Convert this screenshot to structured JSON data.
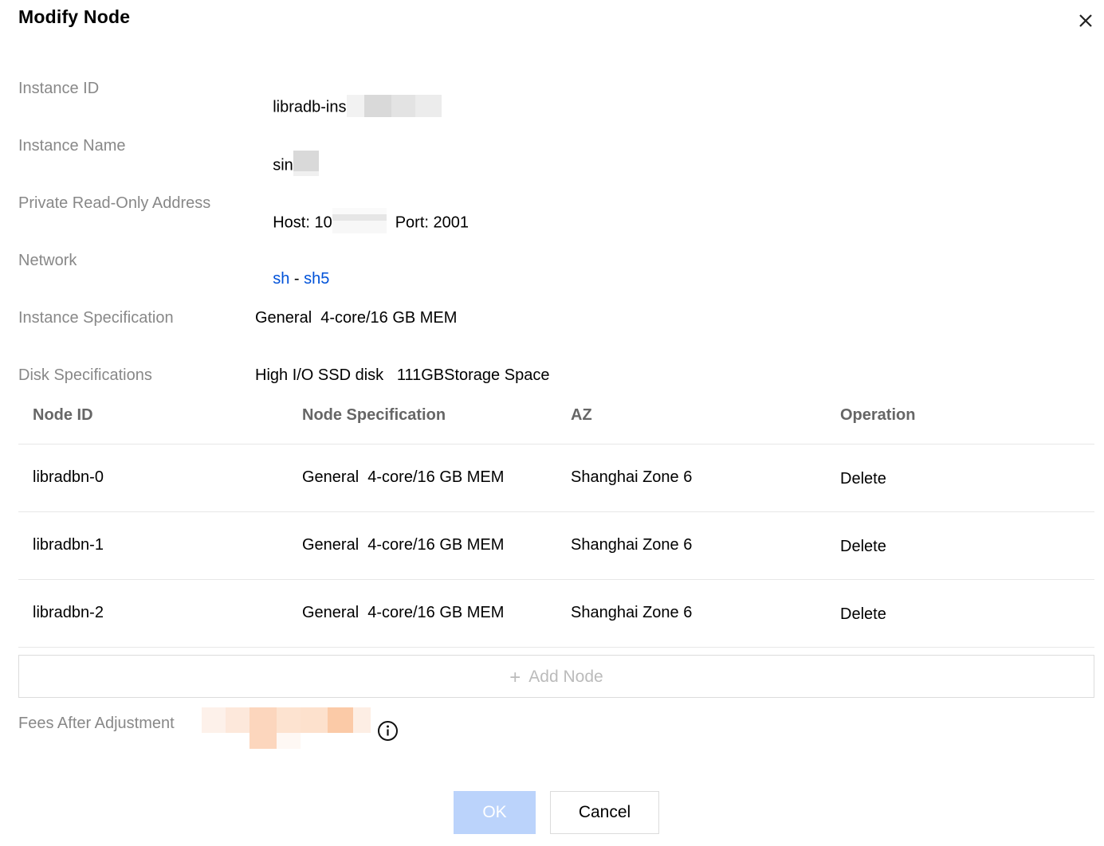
{
  "dialog": {
    "title": "Modify Node",
    "close_icon": "close-icon"
  },
  "info": {
    "instance_id_label": "Instance ID",
    "instance_id_value": "libradb-ins",
    "instance_name_label": "Instance Name",
    "instance_name_value": "sin",
    "address_label": "Private Read-Only Address",
    "address_host": "Host: 10",
    "address_port": "Port: 2001",
    "network_label": "Network",
    "network_vpc": "sh",
    "network_sep": "-",
    "network_subnet": "sh5",
    "spec_label": "Instance Specification",
    "spec_value": "General  4-core/16 GB MEM",
    "disk_label": "Disk Specifications",
    "disk_value": "High I/O SSD disk   111GBStorage Space"
  },
  "table": {
    "headers": [
      "Node ID",
      "Node Specification",
      "AZ",
      "Operation"
    ],
    "rows": [
      {
        "id": "libradbn-0",
        "spec": "General  4-core/16 GB MEM",
        "az": "Shanghai Zone 6",
        "op": "Delete"
      },
      {
        "id": "libradbn-1",
        "spec": "General  4-core/16 GB MEM",
        "az": "Shanghai Zone 6",
        "op": "Delete"
      },
      {
        "id": "libradbn-2",
        "spec": "General  4-core/16 GB MEM",
        "az": "Shanghai Zone 6",
        "op": "Delete"
      }
    ],
    "add_node_label": "Add Node",
    "add_node_icon": "plus-icon"
  },
  "fees": {
    "label": "Fees After Adjustment",
    "info_icon": "info-icon"
  },
  "footer": {
    "ok_label": "OK",
    "cancel_label": "Cancel"
  },
  "colors": {
    "link": "#0052d9",
    "label": "#888888",
    "ok_disabled_bg": "#bbd3fb"
  }
}
